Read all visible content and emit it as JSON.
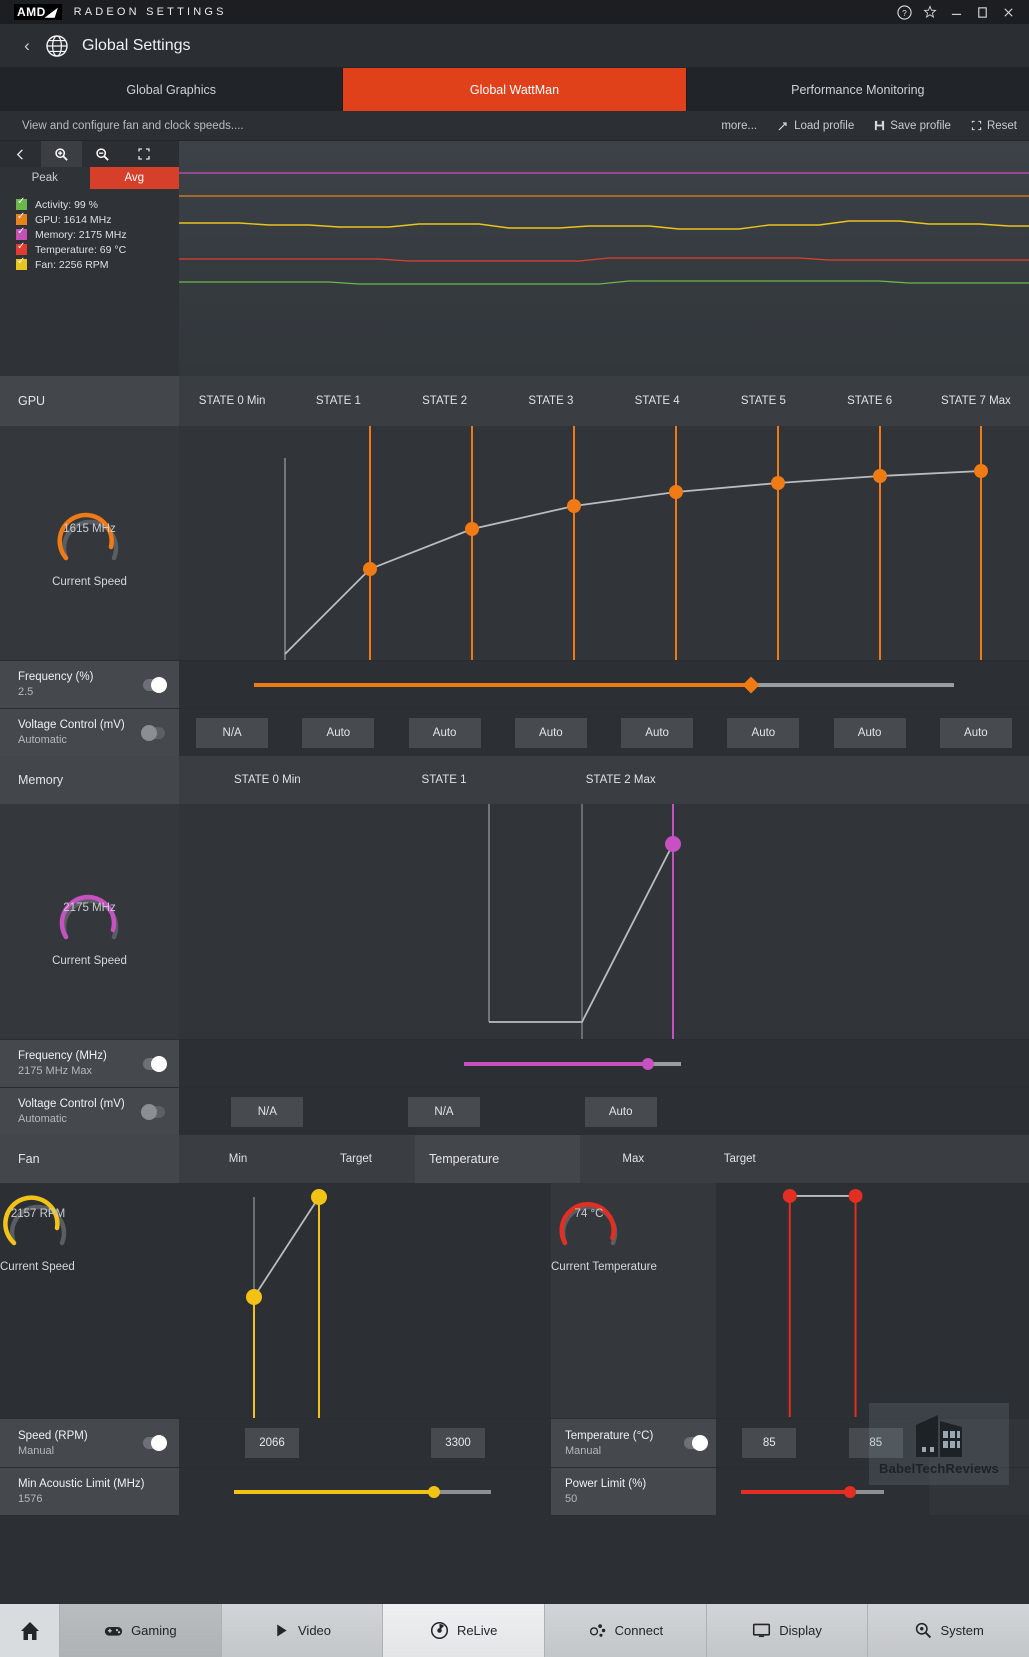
{
  "window": {
    "brand": "AMD",
    "app_title": "RADEON SETTINGS",
    "buttons": [
      "help-icon",
      "star-icon",
      "minimize-icon",
      "maximize-icon",
      "close-icon"
    ]
  },
  "header": {
    "title": "Global Settings",
    "back": "‹",
    "icon": "globe-icon"
  },
  "tabs": [
    {
      "label": "Global Graphics",
      "active": false
    },
    {
      "label": "Global WattMan",
      "active": true
    },
    {
      "label": "Performance Monitoring",
      "active": false
    }
  ],
  "subbar": {
    "description": "View and configure fan and clock speeds....",
    "more": "more...",
    "load_profile": "Load profile",
    "save_profile": "Save profile",
    "reset": "Reset"
  },
  "monitor": {
    "toolbar": [
      "back-icon",
      "zoom-in-icon",
      "zoom-out-icon",
      "fit-icon"
    ],
    "modes": [
      {
        "label": "Peak",
        "active": false
      },
      {
        "label": "Avg",
        "active": true
      }
    ],
    "legend": [
      {
        "label": "Activity: 99 %",
        "color": "#6cb74b"
      },
      {
        "label": "GPU: 1614 MHz",
        "color": "#e8821e"
      },
      {
        "label": "Memory: 2175 MHz",
        "color": "#c551b6"
      },
      {
        "label": "Temperature: 69 °C",
        "color": "#e23c32"
      },
      {
        "label": "Fan: 2256 RPM",
        "color": "#e8c420"
      }
    ]
  },
  "gpu": {
    "section_label": "GPU",
    "states": [
      "STATE 0 Min",
      "STATE 1",
      "STATE 2",
      "STATE 3",
      "STATE 4",
      "STATE 5",
      "STATE 6",
      "STATE 7 Max"
    ],
    "gauge": {
      "value": "1615 MHz",
      "caption": "Current Speed",
      "color": "#f07a14",
      "pct": 78
    },
    "frequency": {
      "label": "Frequency (%)",
      "value": "2.5",
      "toggle": "on",
      "slider_pct": 71,
      "color": "#f07a14"
    },
    "voltage": {
      "label": "Voltage Control (mV)",
      "value": "Automatic",
      "toggle": "off",
      "buttons": [
        "N/A",
        "Auto",
        "Auto",
        "Auto",
        "Auto",
        "Auto",
        "Auto",
        "Auto"
      ]
    },
    "curve": [
      {
        "state": 0,
        "x": 0.125,
        "y": 0.72,
        "marker": false
      },
      {
        "state": 1,
        "x": 0.225,
        "y": 0.6,
        "marker": true
      },
      {
        "state": 2,
        "x": 0.345,
        "y": 0.47,
        "marker": true
      },
      {
        "state": 3,
        "x": 0.465,
        "y": 0.39,
        "marker": true
      },
      {
        "state": 4,
        "x": 0.585,
        "y": 0.33,
        "marker": true
      },
      {
        "state": 5,
        "x": 0.705,
        "y": 0.29,
        "marker": true
      },
      {
        "state": 6,
        "x": 0.825,
        "y": 0.26,
        "marker": true
      },
      {
        "state": 7,
        "x": 0.943,
        "y": 0.24,
        "marker": true
      }
    ]
  },
  "memory": {
    "section_label": "Memory",
    "states": [
      "STATE 0 Min",
      "STATE 1",
      "STATE 2 Max"
    ],
    "gauge": {
      "value": "2175 MHz",
      "caption": "Current Speed",
      "color": "#c651c0",
      "pct": 72
    },
    "frequency": {
      "label": "Frequency (MHz)",
      "value": "2175 MHz Max",
      "toggle": "on",
      "slider_pct": 85,
      "color": "#c651c0"
    },
    "voltage": {
      "label": "Voltage Control (mV)",
      "value": "Automatic",
      "toggle": "off",
      "buttons": [
        "N/A",
        "N/A",
        "Auto"
      ]
    }
  },
  "fan": {
    "section_label": "Fan",
    "columns": [
      "Min",
      "Target"
    ],
    "gauge": {
      "value": "2157 RPM",
      "caption": "Current Speed",
      "color": "#f2c314",
      "pct": 62
    },
    "speed": {
      "label": "Speed (RPM)",
      "value": "Manual",
      "toggle": "on",
      "fields": [
        "2066",
        "3300"
      ]
    },
    "acoustic": {
      "label": "Min Acoustic Limit (MHz)",
      "value": "1576",
      "slider_pct": 78,
      "color": "#f2c314"
    }
  },
  "temperature": {
    "section_label": "Temperature",
    "columns": [
      "Max",
      "Target"
    ],
    "gauge": {
      "value": "74 °C",
      "caption": "Current Temperature",
      "color": "#e22f22",
      "pct": 82
    },
    "temp": {
      "label": "Temperature (°C)",
      "value": "Manual",
      "toggle": "on",
      "fields": [
        "85",
        "85"
      ]
    },
    "power": {
      "label": "Power Limit (%)",
      "value": "50",
      "slider_pct": 76,
      "color": "#e22f22"
    }
  },
  "watermark": {
    "text": "BabelTechReviews"
  },
  "bottomnav": [
    {
      "label": "Gaming",
      "icon": "gamepad-icon",
      "style": "dim"
    },
    {
      "label": "Video",
      "icon": "play-icon",
      "style": "normal"
    },
    {
      "label": "ReLive",
      "icon": "relive-icon",
      "style": "bright"
    },
    {
      "label": "Connect",
      "icon": "connect-icon",
      "style": "normal"
    },
    {
      "label": "Display",
      "icon": "display-icon",
      "style": "normal"
    },
    {
      "label": "System",
      "icon": "system-icon",
      "style": "normal"
    }
  ]
}
